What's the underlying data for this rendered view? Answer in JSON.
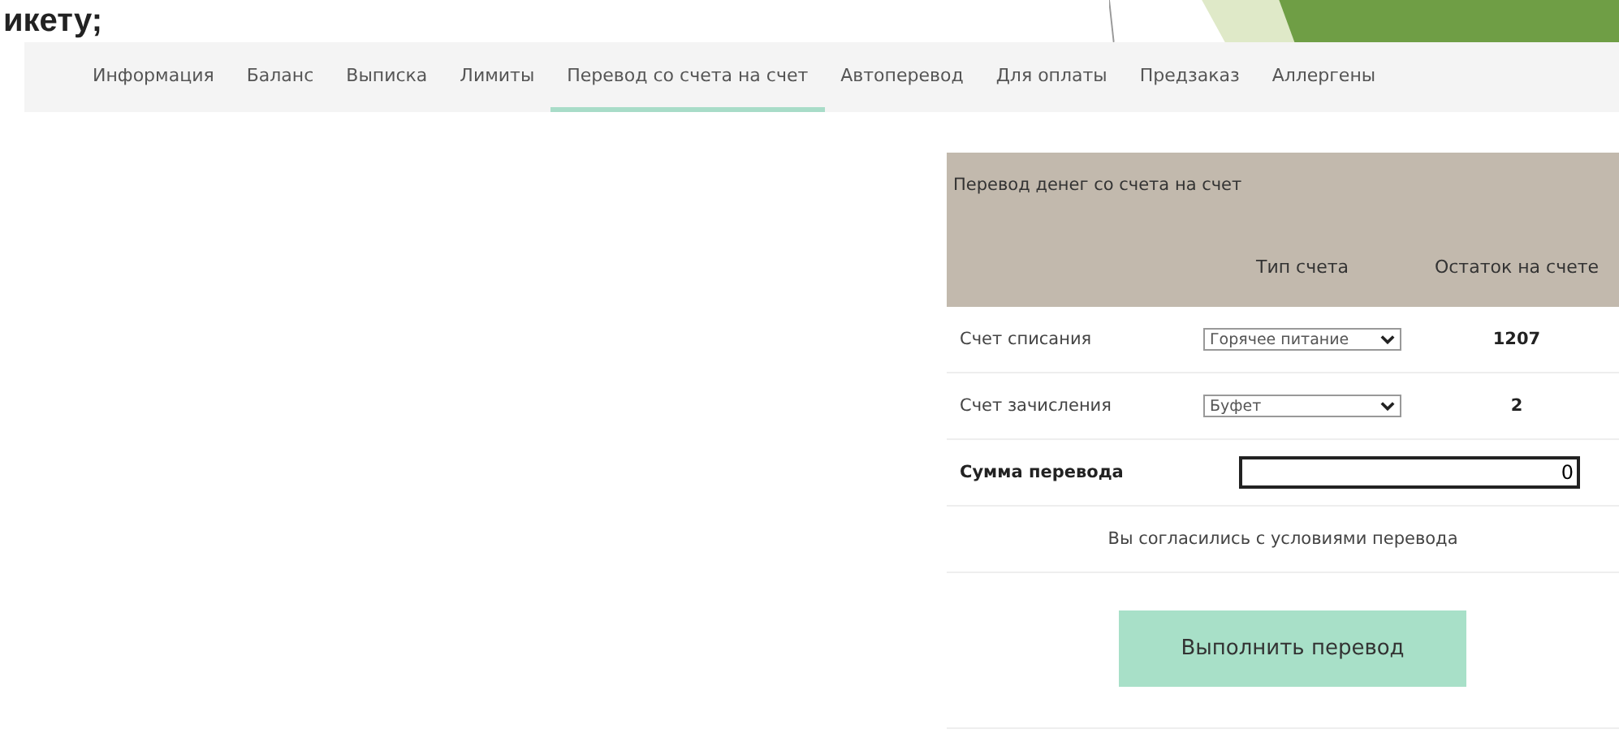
{
  "slide_heading": "икету;",
  "tabs": [
    {
      "label": "Информация",
      "selected": false
    },
    {
      "label": "Баланс",
      "selected": false
    },
    {
      "label": "Выписка",
      "selected": false
    },
    {
      "label": "Лимиты",
      "selected": false
    },
    {
      "label": "Перевод со счета на счет",
      "selected": true
    },
    {
      "label": "Автоперевод",
      "selected": false
    },
    {
      "label": "Для оплаты",
      "selected": false
    },
    {
      "label": "Предзаказ",
      "selected": false
    },
    {
      "label": "Аллергены",
      "selected": false
    }
  ],
  "transfer": {
    "title": "Перевод денег со счета на счет",
    "columns": [
      "Тип счета",
      "Остаток на счете"
    ],
    "rows": [
      {
        "label": "Счет списания",
        "account": "Горячее питание",
        "balance": "1207"
      },
      {
        "label": "Счет зачисления",
        "account": "Буфет",
        "balance": "2"
      }
    ],
    "amount_label": "Сумма перевода",
    "amount": "0",
    "agreement": "Вы согласились с условиями перевода",
    "button": "Выполнить перевод"
  }
}
